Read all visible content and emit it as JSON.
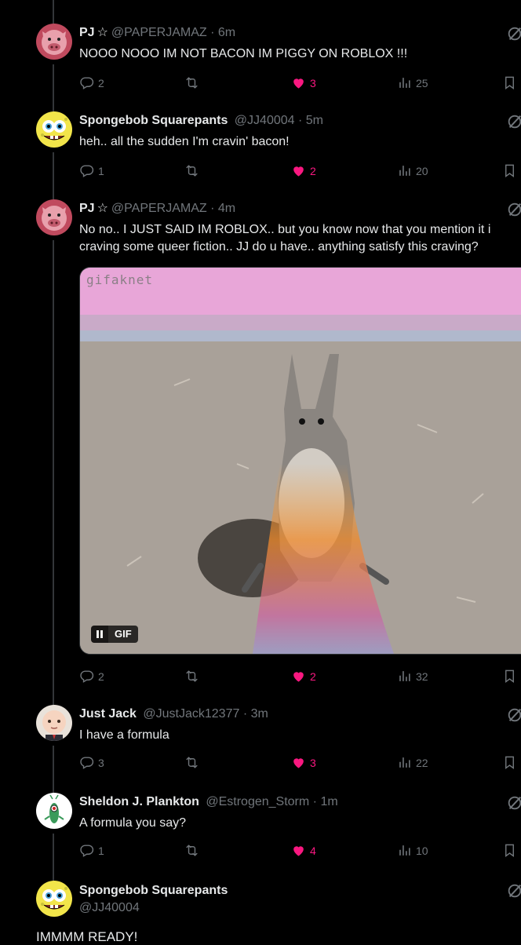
{
  "tweets": [
    {
      "name": "PJ",
      "star": "☆",
      "handle": "@PAPERJAMAZ",
      "time": "6m",
      "text": "NOOO NOOO IM NOT BACON IM PIGGY ON ROBLOX !!!",
      "replies": "2",
      "likes": "3",
      "views": "25",
      "avatar": "piggy-avatar"
    },
    {
      "name": "Spongebob Squarepants",
      "handle": "@JJ40004",
      "time": "5m",
      "text": "heh.. all the sudden I'm cravin' bacon!",
      "replies": "1",
      "likes": "2",
      "views": "20",
      "avatar": "spongebob-avatar"
    },
    {
      "name": "PJ",
      "star": "☆",
      "handle": "@PAPERJAMAZ",
      "time": "4m",
      "text_line1": "No no.. I JUST SAID IM ROBLOX.. but you know now that you mention it i",
      "text_line2": "craving some queer fiction.. JJ do u have.. anything satisfy this craving?",
      "media": {
        "watermark": "gifaknet",
        "badge": "GIF",
        "description": "squirrel-gif"
      },
      "replies": "2",
      "likes": "2",
      "views": "32",
      "avatar": "piggy-avatar"
    },
    {
      "name": "Just Jack",
      "handle": "@JustJack12377",
      "time": "3m",
      "text": "I have a formula",
      "replies": "3",
      "likes": "3",
      "views": "22",
      "avatar": "baby-avatar"
    },
    {
      "name": "Sheldon J. Plankton",
      "handle": "@Estrogen_Storm",
      "time": "1m",
      "text": "A formula you say?",
      "replies": "1",
      "likes": "4",
      "views": "10",
      "avatar": "plankton-avatar"
    },
    {
      "name": "Spongebob Squarepants",
      "handle": "@JJ40004",
      "text": "IMMMM READY!",
      "avatar": "spongebob-avatar"
    }
  ],
  "separator": "·",
  "colors": {
    "like": "#f91880",
    "muted": "#71767b",
    "text": "#e7e9ea",
    "line": "#333639"
  }
}
